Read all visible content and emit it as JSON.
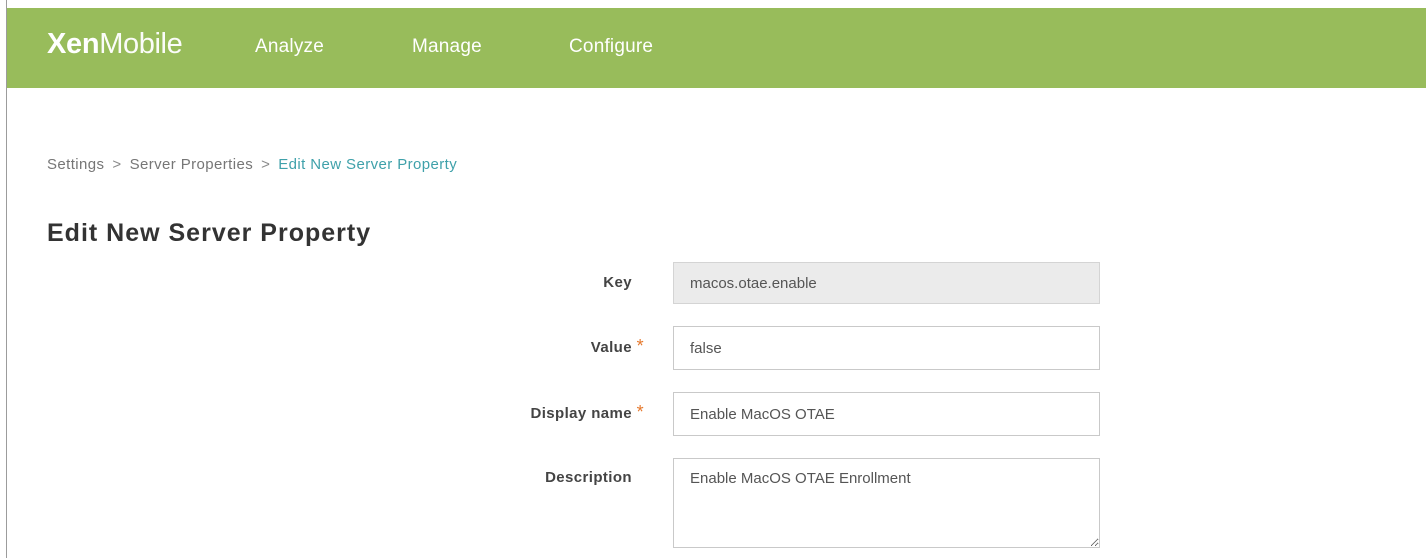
{
  "app": {
    "brand_bold": "Xen",
    "brand_light": "Mobile"
  },
  "nav": [
    {
      "label": "Analyze"
    },
    {
      "label": "Manage"
    },
    {
      "label": "Configure"
    }
  ],
  "breadcrumb": {
    "separator": ">",
    "items": [
      {
        "label": "Settings"
      },
      {
        "label": "Server Properties"
      },
      {
        "label": "Edit New Server Property",
        "current": true
      }
    ]
  },
  "page_title": "Edit New Server Property",
  "form": {
    "fields": [
      {
        "label": "Key",
        "value": "macos.otae.enable",
        "readonly": true
      },
      {
        "label": "Value",
        "required_mark": "*",
        "value": "false"
      },
      {
        "label": "Display name",
        "required_mark": "*",
        "value": "Enable MacOS OTAE"
      },
      {
        "label": "Description",
        "value": "Enable MacOS OTAE Enrollment"
      }
    ]
  },
  "colors": {
    "header_bg": "#98bc5b",
    "breadcrumb_current": "#3fa1aa",
    "required_mark": "#e5782c",
    "readonly_field_bg": "#ebebeb"
  }
}
